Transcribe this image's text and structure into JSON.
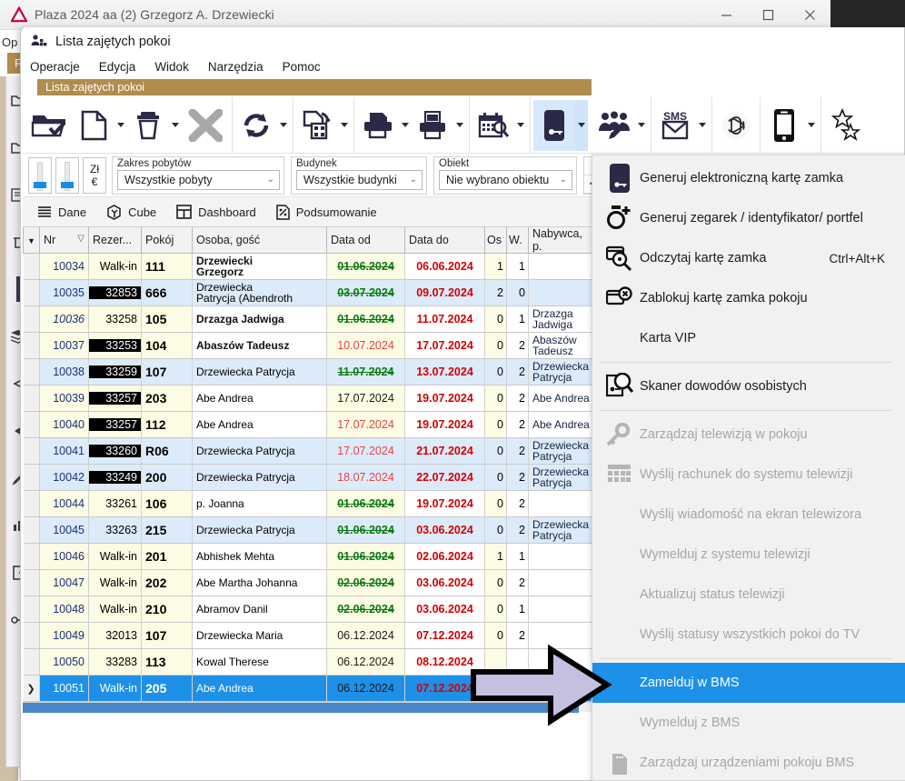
{
  "background_window": {
    "title": "Plaza 2024 aa (2) Grzegorz A. Drzewiecki",
    "menu_label": "Op",
    "tab_label": "F",
    "controls": {
      "minimize": "minimize-icon",
      "maximize": "maximize-icon",
      "close": "close-icon"
    }
  },
  "window": {
    "title": "Lista zajętych pokoi",
    "icon": "rooms-icon",
    "menubar": [
      "Operacje",
      "Edycja",
      "Widok",
      "Narzędzia",
      "Pomoc"
    ],
    "document_tab": "Lista zajętych pokoi"
  },
  "toolbar": {
    "buttons": [
      {
        "name": "open-folder-button",
        "icon": "folder-open-icon",
        "split": false
      },
      {
        "name": "new-document-button",
        "icon": "new-document-icon",
        "split": true
      },
      {
        "name": "delete-button",
        "icon": "trash-icon",
        "split": true
      },
      {
        "name": "cancel-button",
        "icon": "x-mark-icon",
        "split": false
      },
      {
        "name": "refresh-button",
        "icon": "refresh-icon",
        "split": true
      },
      {
        "name": "export-qr-button",
        "icon": "document-qr-icon",
        "split": true
      },
      {
        "name": "print-button",
        "icon": "printer-icon",
        "split": true
      },
      {
        "name": "print-report-button",
        "icon": "fax-report-icon",
        "split": true
      },
      {
        "name": "calendar-search-button",
        "icon": "calendar-search-icon",
        "split": true
      },
      {
        "name": "key-card-button",
        "icon": "key-card-icon",
        "split": true,
        "selected": true
      },
      {
        "name": "guests-edit-button",
        "icon": "guests-edit-icon",
        "split": true
      },
      {
        "name": "sms-button",
        "icon": "sms-envelope-icon",
        "split": true
      },
      {
        "name": "ai-assistant-button",
        "icon": "openai-icon",
        "split": false
      },
      {
        "name": "mobile-button",
        "icon": "smartphone-icon",
        "split": true
      },
      {
        "name": "favorites-button",
        "icon": "stars-icon",
        "split": false
      }
    ]
  },
  "filters": {
    "slider_left": "slider-control",
    "slider_right": "slider-control",
    "currency": {
      "top": "Zł",
      "bottom": "€"
    },
    "groups": [
      {
        "label": "Zakres pobytów",
        "value": "Wszystkie pobyty"
      },
      {
        "label": "Budynek",
        "value": "Wszystkie budynki"
      },
      {
        "label": "Obiekt",
        "value": "Nie wybrano obiektu"
      }
    ],
    "operators": [
      "=",
      ">=",
      "<>",
      "<="
    ]
  },
  "view_tabs": [
    {
      "label": "Dane",
      "icon": "list-lines-icon"
    },
    {
      "label": "Cube",
      "icon": "cube-icon"
    },
    {
      "label": "Dashboard",
      "icon": "dashboard-icon"
    },
    {
      "label": "Podsumowanie",
      "icon": "summary-percent-icon"
    }
  ],
  "grid": {
    "columns": [
      "Nr",
      "Rezer...",
      "Pokój",
      "Osoba, gość",
      "Data od",
      "Data do",
      "Os",
      "W.",
      "Nabywca, p."
    ],
    "rows": [
      {
        "nr": "10034",
        "rezer": "Walk-in",
        "rezer_style": "plain",
        "pokoj": "111",
        "osoba": "Drzewiecki",
        "osoba2": "Grzegorz",
        "osoba_bold": true,
        "from": "01.06.2024",
        "from_style": "strike-green",
        "to": "06.06.2024",
        "os": "1",
        "w": "1",
        "nabywca": "",
        "nabywca2": "",
        "band": "A"
      },
      {
        "nr": "10035",
        "rezer": "32853",
        "rezer_style": "black",
        "pokoj": "666",
        "osoba": "Drzewiecka",
        "osoba2": "Patrycja (Abendroth",
        "osoba_bold": false,
        "from": "03.07.2024",
        "from_style": "strike-green",
        "to": "09.07.2024",
        "os": "2",
        "w": "0",
        "nabywca": "",
        "nabywca2": "",
        "band": "B"
      },
      {
        "nr": "10036",
        "nr_italic": true,
        "rezer": "33258",
        "rezer_style": "plain",
        "pokoj": "105",
        "osoba": "Drzazga Jadwiga",
        "osoba2": "",
        "osoba_bold": true,
        "from": "01.06.2024",
        "from_style": "strike-green",
        "to": "11.07.2024",
        "os": "0",
        "w": "1",
        "nabywca": "Drzazga",
        "nabywca2": "Jadwiga",
        "band": "A"
      },
      {
        "nr": "10037",
        "rezer": "33253",
        "rezer_style": "black",
        "pokoj": "104",
        "osoba": "Abaszów Tadeusz",
        "osoba2": "",
        "osoba_bold": true,
        "from": "10.07.2024",
        "from_style": "plain-red",
        "to": "17.07.2024",
        "os": "0",
        "w": "2",
        "nabywca": "Abaszów",
        "nabywca2": "Tadeusz",
        "band": "A"
      },
      {
        "nr": "10038",
        "rezer": "33259",
        "rezer_style": "black",
        "pokoj": "107",
        "osoba": "Drzewiecka Patrycja",
        "osoba2": "",
        "osoba_bold": false,
        "from": "11.07.2024",
        "from_style": "strike-green",
        "to": "13.07.2024",
        "os": "0",
        "w": "2",
        "nabywca": "Drzewiecka",
        "nabywca2": "Patrycja",
        "band": "B"
      },
      {
        "nr": "10039",
        "rezer": "33257",
        "rezer_style": "black",
        "pokoj": "203",
        "osoba": "Abe Andrea",
        "osoba2": "",
        "osoba_bold": false,
        "from": "17.07.2024",
        "from_style": "plain-black",
        "to": "19.07.2024",
        "os": "0",
        "w": "2",
        "nabywca": "Abe Andrea",
        "nabywca2": "",
        "band": "A"
      },
      {
        "nr": "10040",
        "rezer": "33257",
        "rezer_style": "black",
        "pokoj": "112",
        "osoba": "Abe Andrea",
        "osoba2": "",
        "osoba_bold": false,
        "from": "17.07.2024",
        "from_style": "plain-red",
        "to": "19.07.2024",
        "os": "0",
        "w": "2",
        "nabywca": "Abe Andrea",
        "nabywca2": "",
        "band": "A"
      },
      {
        "nr": "10041",
        "rezer": "33260",
        "rezer_style": "black",
        "pokoj": "R06",
        "osoba": "Drzewiecka Patrycja",
        "osoba2": "",
        "osoba_bold": false,
        "from": "17.07.2024",
        "from_style": "plain-red",
        "to": "21.07.2024",
        "os": "0",
        "w": "2",
        "nabywca": "Drzewiecka",
        "nabywca2": "Patrycja",
        "band": "B"
      },
      {
        "nr": "10042",
        "rezer": "33249",
        "rezer_style": "black",
        "pokoj": "200",
        "osoba": "Drzewiecka Patrycja",
        "osoba2": "",
        "osoba_bold": false,
        "from": "18.07.2024",
        "from_style": "plain-red",
        "to": "22.07.2024",
        "os": "0",
        "w": "2",
        "nabywca": "Drzewiecka",
        "nabywca2": "Patrycja",
        "band": "B"
      },
      {
        "nr": "10044",
        "rezer": "33261",
        "rezer_style": "plain",
        "pokoj": "106",
        "osoba": "p. Joanna",
        "osoba2": "",
        "osoba_bold": false,
        "from": "01.06.2024",
        "from_style": "strike-green",
        "to": "19.07.2024",
        "os": "0",
        "w": "2",
        "nabywca": "",
        "nabywca2": "",
        "band": "A"
      },
      {
        "nr": "10045",
        "rezer": "33263",
        "rezer_style": "plain",
        "pokoj": "215",
        "osoba": "Drzewiecka Patrycja",
        "osoba2": "",
        "osoba_bold": false,
        "from": "01.06.2024",
        "from_style": "strike-green",
        "to": "03.06.2024",
        "os": "0",
        "w": "2",
        "nabywca": "Drzewiecka",
        "nabywca2": "Patrycja",
        "band": "B"
      },
      {
        "nr": "10046",
        "rezer": "Walk-in",
        "rezer_style": "plain",
        "pokoj": "201",
        "osoba": "Abhishek Mehta",
        "osoba2": "",
        "osoba_bold": false,
        "from": "01.06.2024",
        "from_style": "strike-green",
        "to": "02.06.2024",
        "os": "1",
        "w": "1",
        "nabywca": "",
        "nabywca2": "",
        "band": "A"
      },
      {
        "nr": "10047",
        "rezer": "Walk-in",
        "rezer_style": "plain",
        "pokoj": "202",
        "osoba": "Abe Martha Johanna",
        "osoba2": "",
        "osoba_bold": false,
        "from": "02.06.2024",
        "from_style": "strike-green",
        "to": "03.06.2024",
        "os": "0",
        "w": "2",
        "nabywca": "",
        "nabywca2": "",
        "band": "A"
      },
      {
        "nr": "10048",
        "rezer": "Walk-in",
        "rezer_style": "plain",
        "pokoj": "210",
        "osoba": "Abramov Danil",
        "osoba2": "",
        "osoba_bold": false,
        "from": "02.06.2024",
        "from_style": "strike-green",
        "to": "03.06.2024",
        "os": "0",
        "w": "1",
        "nabywca": "",
        "nabywca2": "",
        "band": "A"
      },
      {
        "nr": "10049",
        "rezer": "32013",
        "rezer_style": "plain",
        "pokoj": "107",
        "osoba": "Drzewiecka Maria",
        "osoba2": "",
        "osoba_bold": false,
        "from": "06.12.2024",
        "from_style": "plain-black",
        "to": "07.12.2024",
        "os": "0",
        "w": "2",
        "nabywca": "",
        "nabywca2": "",
        "band": "A"
      },
      {
        "nr": "10050",
        "rezer": "33283",
        "rezer_style": "plain",
        "pokoj": "113",
        "osoba": "Kowal Therese",
        "osoba2": "",
        "osoba_bold": false,
        "from": "06.12.2024",
        "from_style": "plain-black",
        "to": "08.12.2024",
        "os": "",
        "w": "",
        "nabywca": "",
        "nabywca2": "",
        "band": "A"
      },
      {
        "nr": "10051",
        "rezer": "Walk-in",
        "rezer_style": "plain",
        "pokoj": "205",
        "osoba": "Abe Andrea",
        "osoba2": "",
        "osoba_bold": false,
        "from": "06.12.2024",
        "from_style": "plain-black",
        "to": "07.12.2024",
        "os": "",
        "w": "",
        "nabywca": "",
        "nabywca2": "",
        "band": "SEL",
        "selected": true
      }
    ]
  },
  "context_menu": {
    "items": [
      {
        "label": "Generuj elektroniczną kartę zamka",
        "icon": "key-card-icon",
        "shortcut": "",
        "state": "enabled"
      },
      {
        "label": "Generuj zegarek / identyfikator/ portfel",
        "icon": "watch-plus-icon",
        "shortcut": "",
        "state": "enabled"
      },
      {
        "label": "Odczytaj kartę zamka",
        "icon": "card-read-icon",
        "shortcut": "Ctrl+Alt+K",
        "state": "enabled"
      },
      {
        "label": "Zablokuj kartę zamka pokoju",
        "icon": "card-block-icon",
        "shortcut": "",
        "state": "enabled"
      },
      {
        "label": "Karta VIP",
        "icon": "",
        "shortcut": "",
        "state": "enabled"
      },
      {
        "separator": true
      },
      {
        "label": "Skaner dowodów osobistych",
        "icon": "id-scanner-icon",
        "shortcut": "",
        "state": "enabled"
      },
      {
        "separator": true
      },
      {
        "label": "Zarządzaj telewizją w pokoju",
        "icon": "key-icon",
        "shortcut": "",
        "state": "disabled"
      },
      {
        "label": "Wyślij rachunek do systemu telewizji",
        "icon": "grid-squares-icon",
        "shortcut": "",
        "state": "disabled"
      },
      {
        "label": "Wyślij wiadomość na ekran telewizora",
        "icon": "",
        "shortcut": "",
        "state": "disabled"
      },
      {
        "label": "Wymelduj z systemu telewizji",
        "icon": "",
        "shortcut": "",
        "state": "disabled"
      },
      {
        "label": "Aktualizuj status telewizji",
        "icon": "",
        "shortcut": "",
        "state": "disabled"
      },
      {
        "label": "Wyślij statusy wszystkich pokoi do TV",
        "icon": "",
        "shortcut": "",
        "state": "disabled"
      },
      {
        "separator": true
      },
      {
        "label": "Zamelduj w BMS",
        "icon": "",
        "shortcut": "",
        "state": "highlighted"
      },
      {
        "label": "Wymelduj z BMS",
        "icon": "",
        "shortcut": "",
        "state": "disabled"
      },
      {
        "label": "Zarządzaj urządzeniami pokoju BMS",
        "icon": "device-card-icon",
        "shortcut": "",
        "state": "disabled"
      }
    ]
  },
  "annotation": {
    "arrow": "right-arrow-annotation",
    "fill": "#c6c0e0"
  },
  "colors": {
    "accent_blue": "#1e90e8",
    "tab_gold": "#b08d4d",
    "row_cream": "#fcfbe3",
    "row_blue": "#dcebf9",
    "date_red": "#d40000",
    "date_green": "#0a7a10"
  }
}
